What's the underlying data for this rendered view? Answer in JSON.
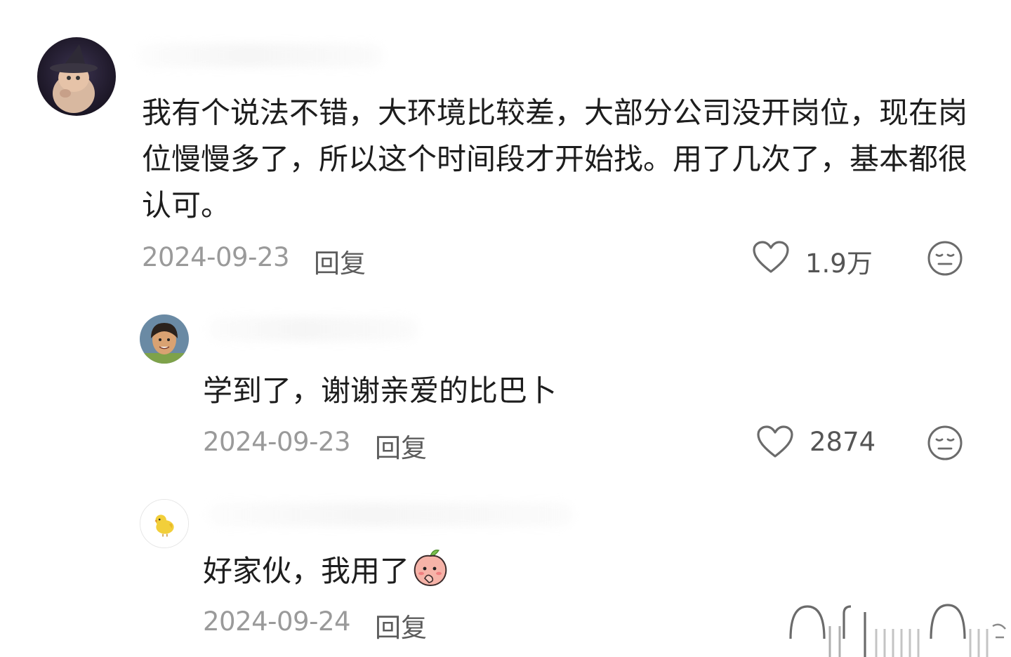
{
  "comments": [
    {
      "text": "我有个说法不错，大环境比较差，大部分公司没开岗位，现在岗位慢慢多了，所以这个时间段才开始找。用了几次了，基本都很认可。",
      "date": "2024-09-23",
      "reply_label": "回复",
      "likes": "1.9万"
    },
    {
      "text": "学到了，谢谢亲爱的比巴卜",
      "date": "2024-09-23",
      "reply_label": "回复",
      "likes": "2874"
    },
    {
      "text": "好家伙，我用了",
      "date": "2024-09-24",
      "reply_label": "回复",
      "likes": ""
    }
  ],
  "icons": {
    "like": "heart-outline-icon",
    "dislike": "neutral-face-icon",
    "emoji": "peach-emoji-icon"
  },
  "colors": {
    "text": "#1d1d1d",
    "date": "#9a9a9a",
    "reply": "#5c5c5c",
    "icon": "#6b6b6b"
  }
}
